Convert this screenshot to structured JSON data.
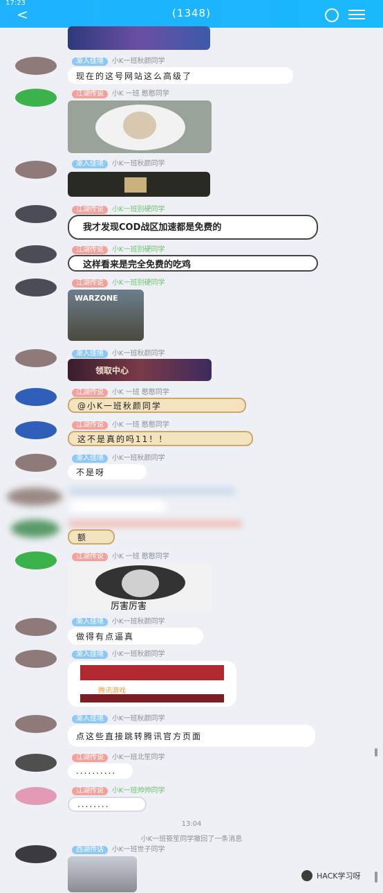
{
  "status_bar": {
    "time": "17:23"
  },
  "header": {
    "title": "(1348)"
  },
  "messages": [
    {
      "badge": "渐入佳境",
      "name": "小K一班秋颜同学",
      "text": "现在的这号网站这么高级了"
    },
    {
      "badge": "江湖传说",
      "name": "小K 一班 憨憨同学"
    },
    {
      "badge": "渐入佳境",
      "name": "小K一班秋颜同学"
    },
    {
      "badge": "江湖传说",
      "name": "小K一班别硬同学",
      "text": "我才发现COD战区加速都是免费的"
    },
    {
      "badge": "江湖传说",
      "name": "小K一班别硬同学",
      "text": "这样看来是完全免费的吃鸡"
    },
    {
      "badge": "江湖传说",
      "name": "小K一班别硬同学",
      "image_text": "WARZONE"
    },
    {
      "badge": "渐入佳境",
      "name": "小K一班秋颜同学",
      "image_text": "领取中心"
    },
    {
      "badge": "江湖传说",
      "name": "小K 一班 憨憨同学",
      "text": "@小K一班秋颜同学"
    },
    {
      "badge": "江湖传说",
      "name": "小K 一班 憨憨同学",
      "text": "这不是真的吗11！！"
    },
    {
      "badge": "渐入佳境",
      "name": "小K一班秋颜同学",
      "text": "不是呀"
    },
    {
      "text": "额"
    },
    {
      "badge": "江湖传说",
      "name": "小K 一班 憨憨同学",
      "image_text": "厉害厉害"
    },
    {
      "badge": "渐入佳境",
      "name": "小K一班秋颜同学",
      "text": "做得有点逼真"
    },
    {
      "badge": "渐入佳境",
      "name": "小K一班秋颜同学",
      "image_text": "腾讯游戏"
    },
    {
      "badge": "渐入佳境",
      "name": "小K一班秋颜同学",
      "text": "点这些直接跳转腾讯官方页面"
    },
    {
      "badge": "江湖传说",
      "name": "小K一班北笙同学",
      "text": ".........."
    },
    {
      "badge": "江湖传说",
      "name": "小K一班帅帅同学",
      "text": "........"
    },
    {
      "badge": "西湖传话",
      "name": "小K一班世子同学"
    }
  ],
  "system": {
    "time": "13:04",
    "recall": "小K一班筱笙同学撤回了一条消息"
  },
  "watermark": {
    "text": "HACK学习呀"
  },
  "colors": {
    "header": "#1fb2ff",
    "background": "#eef0f5"
  }
}
